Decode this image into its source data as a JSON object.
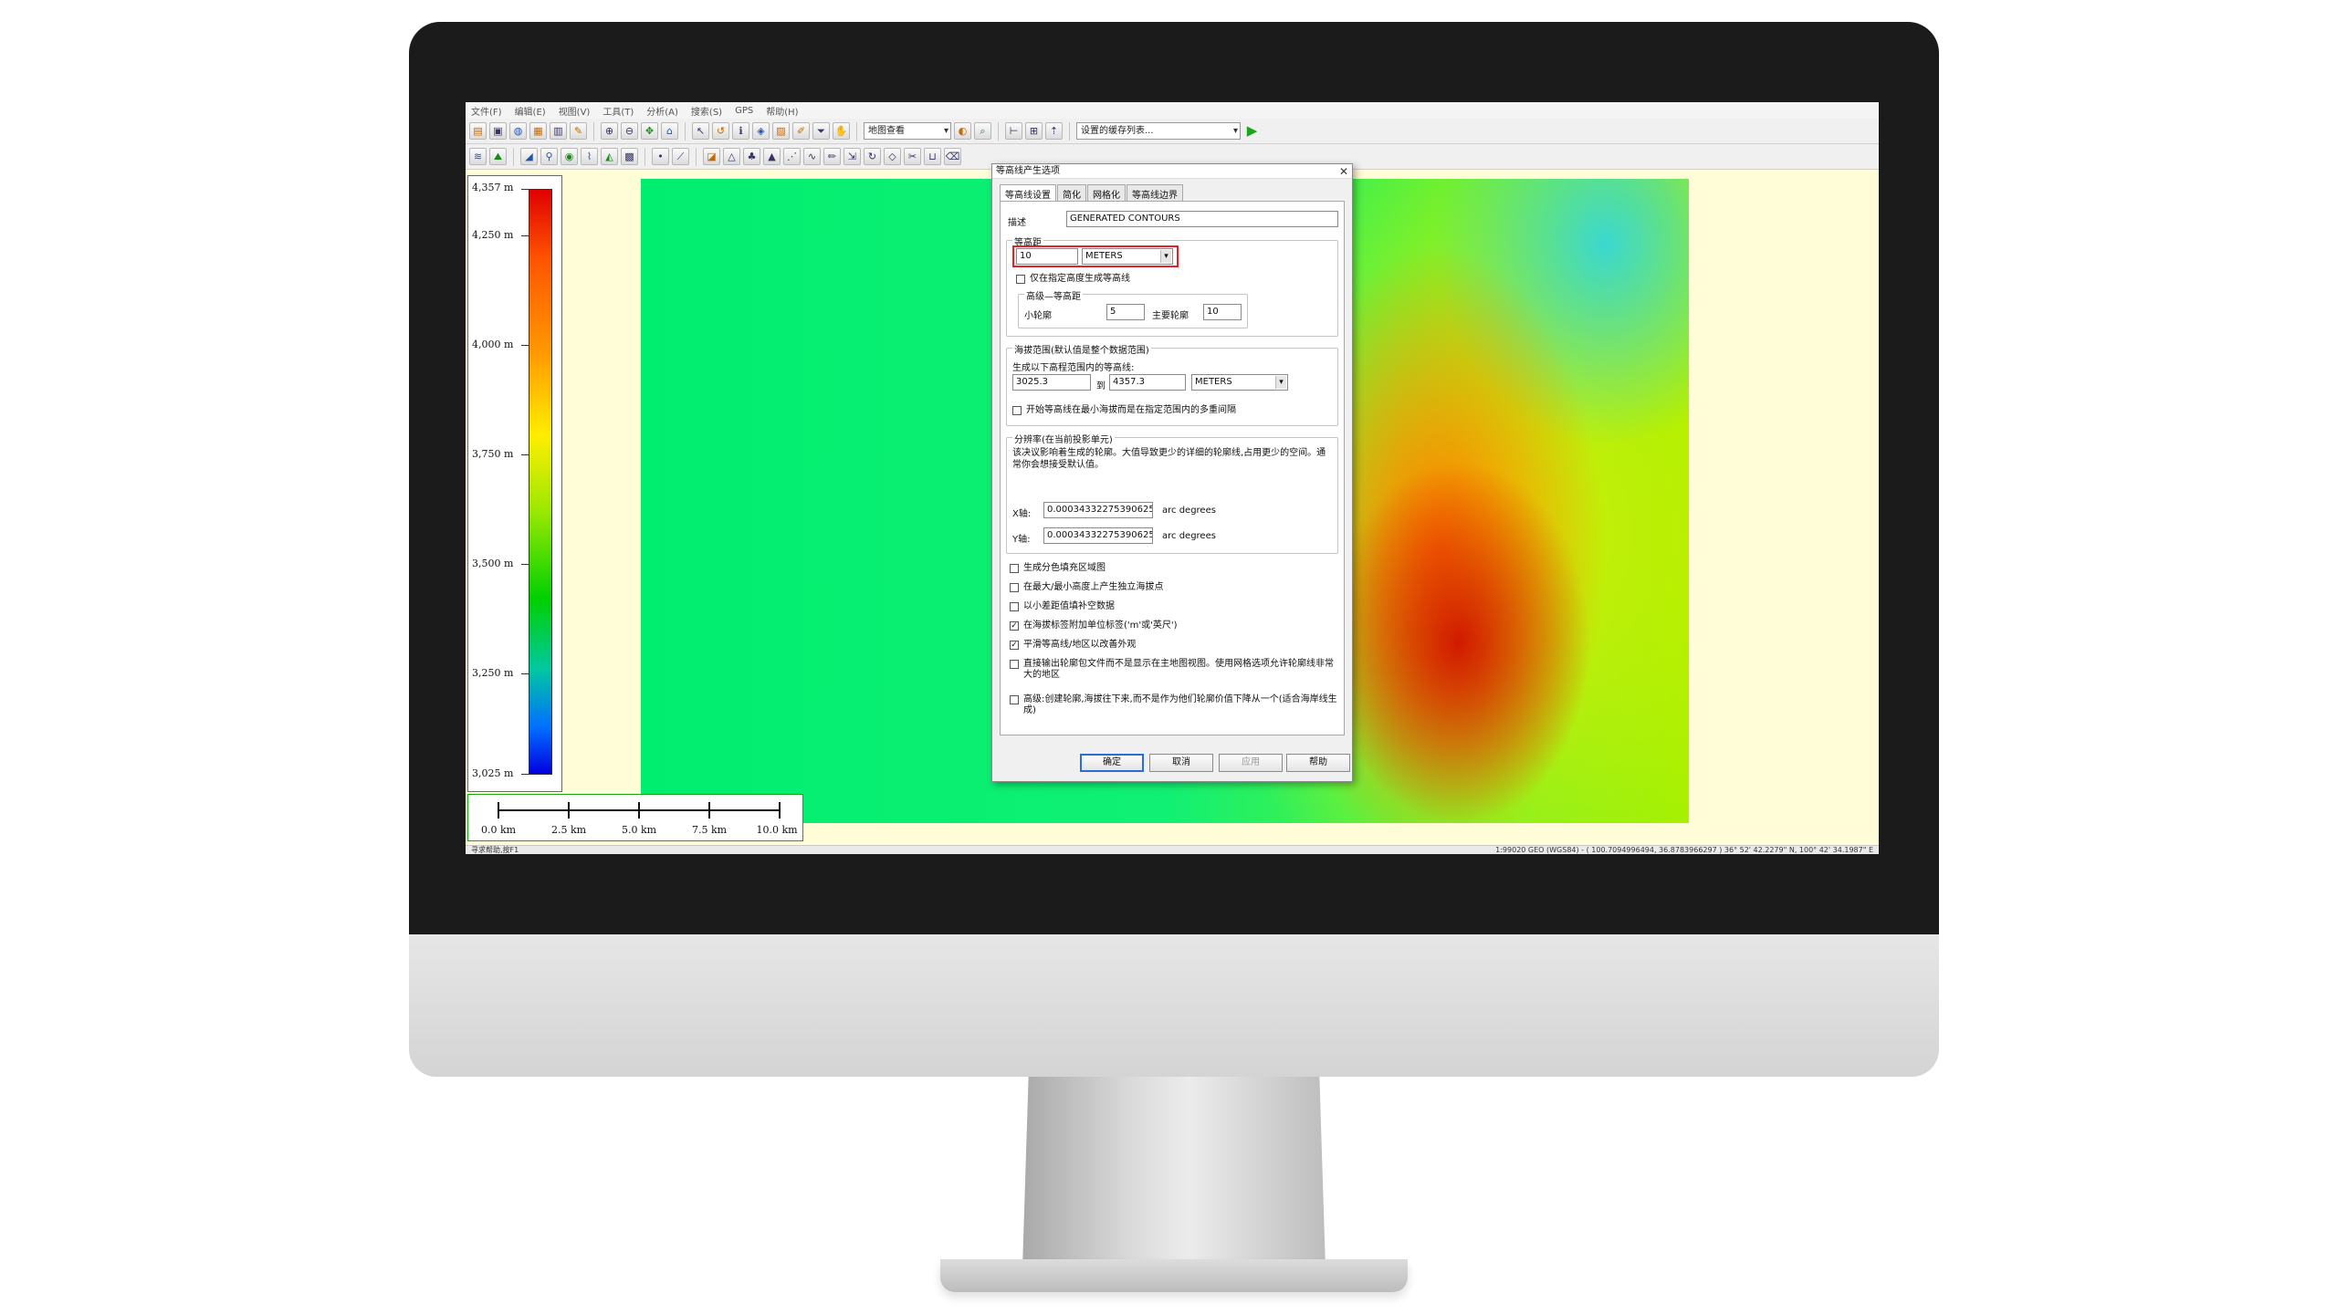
{
  "menu": [
    "文件(F)",
    "编辑(E)",
    "视图(V)",
    "工具(T)",
    "分析(A)",
    "搜索(S)",
    "GPS",
    "帮助(H)"
  ],
  "toolbar": {
    "layer_combo": "地图查看",
    "workspace_combo": "设置的缓存列表...",
    "row1_icons": [
      "open-icon",
      "save-icon",
      "globe-icon",
      "image-icon",
      "grid-icon",
      "tool-icon",
      "zoom-in-icon",
      "zoom-out-icon",
      "pan-icon",
      "home-icon",
      "select-icon",
      "measure-icon",
      "info-icon",
      "layers-icon",
      "text-icon",
      "draw-icon",
      "filter-icon",
      "hand-icon"
    ],
    "row1b_icons": [
      "globe2-icon",
      "search-icon",
      "cursor-icon",
      "path-icon",
      "arrow-up-icon"
    ],
    "row2_icons": [
      "contour-icon",
      "terrain-icon",
      "slope-icon",
      "watershed-icon",
      "viewshed-icon",
      "profile-icon",
      "shade-icon",
      "mesh-icon",
      "point-icon",
      "line-icon",
      "area-icon",
      "feature-icon",
      "tree-icon",
      "building-icon",
      "road-icon",
      "river-icon",
      "edit-icon",
      "move-icon",
      "rotate-icon",
      "vertex-icon",
      "split-icon",
      "merge-icon",
      "erase-icon"
    ]
  },
  "legend": {
    "labels": [
      "4,357 m",
      "4,250 m",
      "4,000 m",
      "3,750 m",
      "3,500 m",
      "3,250 m",
      "3,025 m"
    ],
    "colors": [
      "#e00000",
      "#ff9900",
      "#ffee00",
      "#00d000",
      "#0000e0"
    ]
  },
  "scale": {
    "labels": [
      "0.0 km",
      "2.5 km",
      "5.0 km",
      "7.5 km",
      "10.0 km"
    ]
  },
  "status": {
    "left": "寻求帮助,按F1",
    "right": "1:99020  GEO (WGS84) - ( 100.7094996494, 36.8783966297 )  36° 52' 42.2279\" N, 100° 42' 34.1987\" E"
  },
  "dialog": {
    "title": "等高线产生选项",
    "close": "✕",
    "tabs": [
      "等高线设置",
      "简化",
      "网格化",
      "等高线边界"
    ],
    "description_label": "描述",
    "description_value": "GENERATED CONTOURS",
    "interval_group": "等高距",
    "interval_value": "10",
    "interval_unit": "METERS",
    "only_specified_label": "仅在指定高度生成等高线",
    "sub_group": "高级—等高距",
    "minor_label": "小轮廓",
    "minor_value": "5",
    "major_label": "主要轮廓",
    "major_value": "10",
    "range_group": "海拔范围(默认值是整个数据范围)",
    "range_hint": "生成以下高程范围内的等高线:",
    "range_from": "3025.3",
    "range_to_label": "到",
    "range_to": "4357.3",
    "range_unit": "METERS",
    "range_check_label": "开始等高线在最小海拔而是在指定范围内的多重间隔",
    "res_group": "分辨率(在当前投影单元)",
    "res_note": "该决议影响着生成的轮廓。大值导致更少的详细的轮廓线,占用更少的空间。通常你会想接受默认值。",
    "x_label": "X轴:",
    "x_value": "0.00034332275390625",
    "y_label": "Y轴:",
    "y_value": "0.00034332275390625",
    "res_unit": "arc degrees",
    "options": [
      {
        "label": "生成分色填充区域图",
        "checked": false
      },
      {
        "label": "在最大/最小高度上产生独立海拔点",
        "checked": false
      },
      {
        "label": "以小差距值填补空数据",
        "checked": false
      },
      {
        "label": "在海拔标签附加单位标签('m'或'英尺')",
        "checked": true
      },
      {
        "label": "平滑等高线/地区以改善外观",
        "checked": true
      },
      {
        "label": "直接输出轮廓包文件而不是显示在主地图视图。使用网格选项允许轮廓线非常大的地区",
        "checked": false
      },
      {
        "label": "高级:创建轮廓,海拔往下来,而不是作为他们轮廓价值下降从一个(适合海岸线生成)",
        "checked": false
      }
    ],
    "buttons": {
      "ok": "确定",
      "cancel": "取消",
      "apply": "应用",
      "help": "帮助"
    }
  }
}
